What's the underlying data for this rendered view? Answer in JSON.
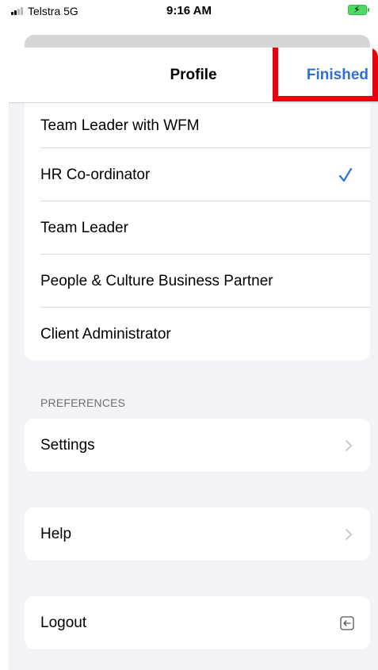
{
  "status_bar": {
    "carrier": "Telstra  5G",
    "time": "9:16 AM",
    "battery_icon": "battery-charging-icon",
    "signal_icon": "cellular-signal-icon"
  },
  "header": {
    "title": "Profile",
    "done_label": "Finished",
    "accent_color": "#2f6fd8",
    "highlight_color": "#e8000d"
  },
  "profiles": [
    {
      "label": "Team Leader with WFM",
      "selected": false
    },
    {
      "label": "HR Co-ordinator",
      "selected": true
    },
    {
      "label": "Team Leader",
      "selected": false
    },
    {
      "label": "People & Culture Business Partner",
      "selected": false
    },
    {
      "label": "Client Administrator",
      "selected": false
    }
  ],
  "preferences": {
    "header": "PREFERENCES",
    "settings_label": "Settings"
  },
  "help": {
    "label": "Help"
  },
  "logout": {
    "label": "Logout",
    "icon": "logout-icon"
  }
}
